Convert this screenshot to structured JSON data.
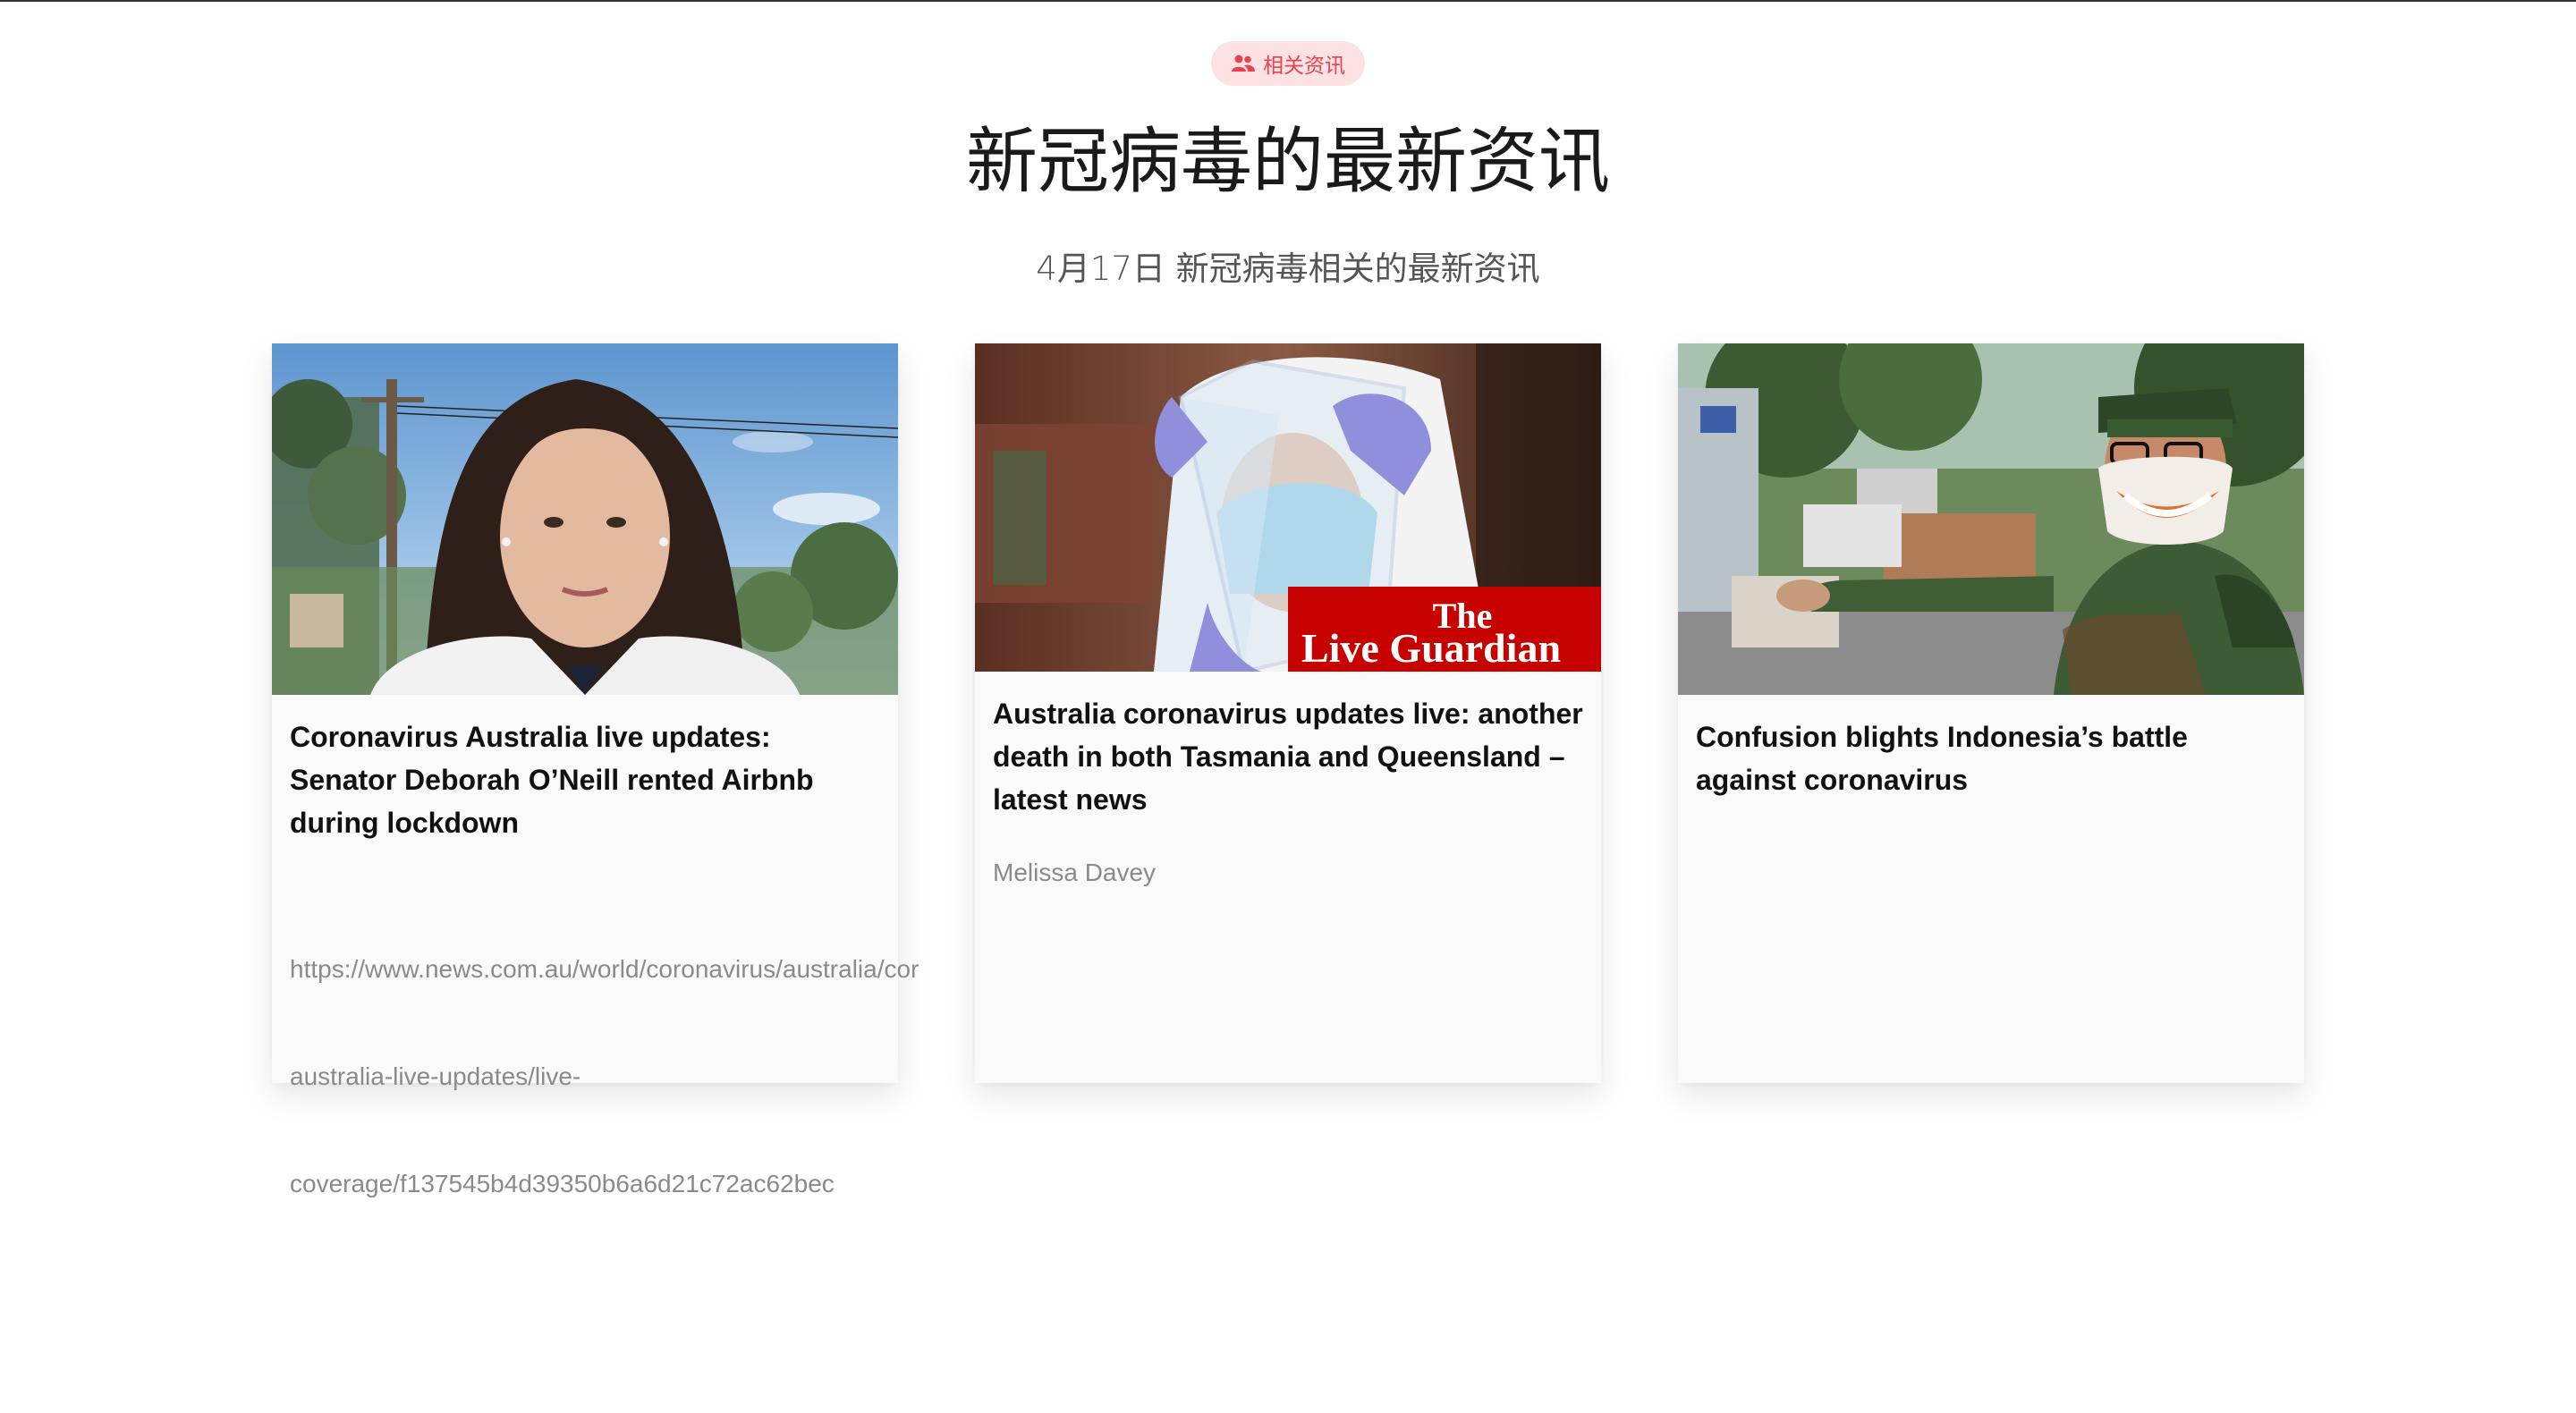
{
  "section": {
    "badge_label": "相关资讯",
    "badge_icon": "users-icon",
    "title": "新冠病毒的最新资讯",
    "subtitle": "4月17日 新冠病毒相关的最新资讯",
    "accent_color": "#e8424f",
    "badge_bg": "#fde2e3"
  },
  "cards": [
    {
      "headline": "Coronavirus Australia live updates: Senator Deborah O’Neill rented Airbnb during lockdown",
      "url_lines": [
        "https://www.news.com.au/world/coronavirus/australia/cor",
        "australia-live-updates/live-",
        "coverage/f137545b4d39350b6a6d21c72ac62bec"
      ]
    },
    {
      "headline": "Australia coronavirus updates live: another death in both Tasmania and Queensland – latest news",
      "author": "Melissa Davey",
      "logo_text": "The Guardian Live"
    },
    {
      "headline": "Confusion blights Indonesia’s battle against coronavirus"
    }
  ]
}
